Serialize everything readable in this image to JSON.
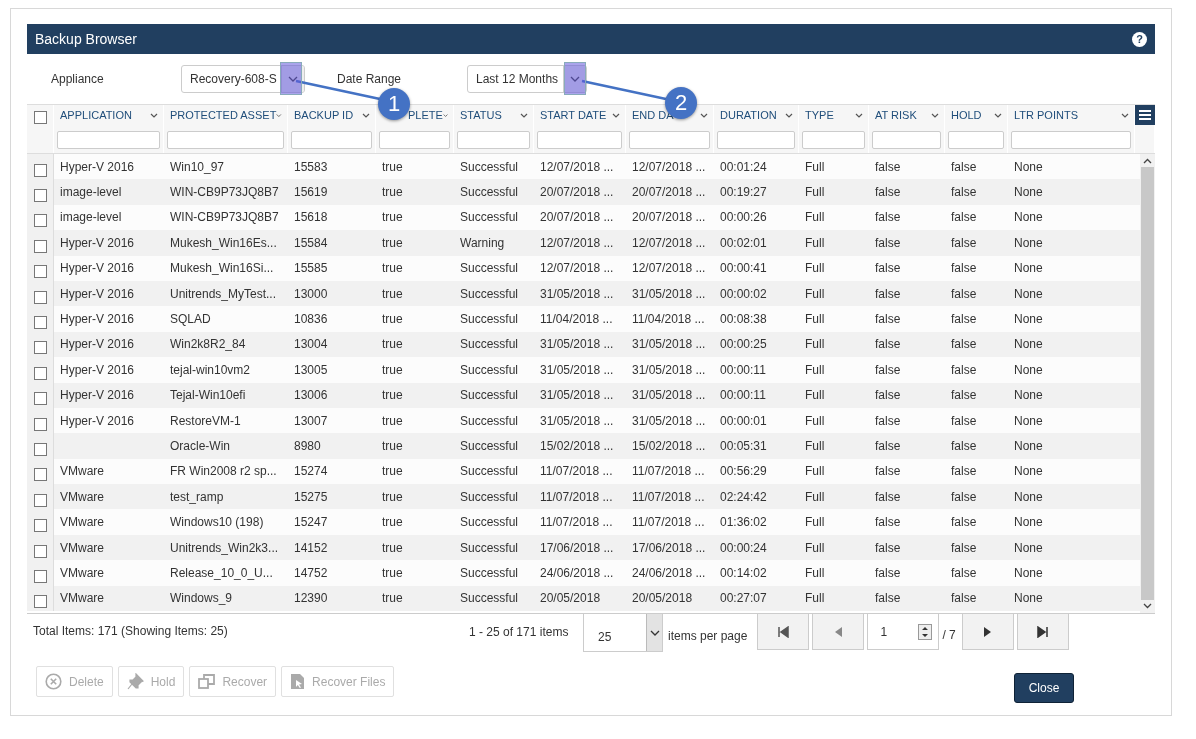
{
  "window": {
    "title": "Backup Browser",
    "help": "?"
  },
  "filters": [
    {
      "label": "Appliance",
      "value": "Recovery-608-S"
    },
    {
      "label": "Date Range",
      "value": "Last 12 Months"
    }
  ],
  "table": {
    "select_all": {
      "checked": false
    },
    "columns": [
      {
        "label": "APPLICATION"
      },
      {
        "label": "PROTECTED ASSET"
      },
      {
        "label": "BACKUP ID"
      },
      {
        "label": "PLETE"
      },
      {
        "label": "STATUS"
      },
      {
        "label": "START DATE"
      },
      {
        "label": "END DA"
      },
      {
        "label": "DURATION"
      },
      {
        "label": "TYPE"
      },
      {
        "label": "AT RISK"
      },
      {
        "label": "HOLD"
      },
      {
        "label": "LTR POINTS"
      }
    ],
    "rows": [
      {
        "checked": false,
        "cells": [
          "Hyper-V 2016",
          "Win10_97",
          "15583",
          "true",
          "Successful",
          "12/07/2018 ...",
          "12/07/2018 ...",
          "00:01:24",
          "Full",
          "false",
          "false",
          "None"
        ]
      },
      {
        "checked": false,
        "cells": [
          "image-level",
          "WIN-CB9P73JQ8B7",
          "15619",
          "true",
          "Successful",
          "20/07/2018 ...",
          "20/07/2018 ...",
          "00:19:27",
          "Full",
          "false",
          "false",
          "None"
        ]
      },
      {
        "checked": false,
        "cells": [
          "image-level",
          "WIN-CB9P73JQ8B7",
          "15618",
          "true",
          "Successful",
          "20/07/2018 ...",
          "20/07/2018 ...",
          "00:00:26",
          "Full",
          "false",
          "false",
          "None"
        ]
      },
      {
        "checked": false,
        "cells": [
          "Hyper-V 2016",
          "Mukesh_Win16Es...",
          "15584",
          "true",
          "Warning",
          "12/07/2018 ...",
          "12/07/2018 ...",
          "00:02:01",
          "Full",
          "false",
          "false",
          "None"
        ]
      },
      {
        "checked": false,
        "cells": [
          "Hyper-V 2016",
          "Mukesh_Win16Si...",
          "15585",
          "true",
          "Successful",
          "12/07/2018 ...",
          "12/07/2018 ...",
          "00:00:41",
          "Full",
          "false",
          "false",
          "None"
        ]
      },
      {
        "checked": false,
        "cells": [
          "Hyper-V 2016",
          "Unitrends_MyTest...",
          "13000",
          "true",
          "Successful",
          "31/05/2018 ...",
          "31/05/2018 ...",
          "00:00:02",
          "Full",
          "false",
          "false",
          "None"
        ]
      },
      {
        "checked": false,
        "cells": [
          "Hyper-V 2016",
          "SQLAD",
          "10836",
          "true",
          "Successful",
          "11/04/2018 ...",
          "11/04/2018 ...",
          "00:08:38",
          "Full",
          "false",
          "false",
          "None"
        ]
      },
      {
        "checked": false,
        "cells": [
          "Hyper-V 2016",
          "Win2k8R2_84",
          "13004",
          "true",
          "Successful",
          "31/05/2018 ...",
          "31/05/2018 ...",
          "00:00:25",
          "Full",
          "false",
          "false",
          "None"
        ]
      },
      {
        "checked": false,
        "cells": [
          "Hyper-V 2016",
          "tejal-win10vm2",
          "13005",
          "true",
          "Successful",
          "31/05/2018 ...",
          "31/05/2018 ...",
          "00:00:11",
          "Full",
          "false",
          "false",
          "None"
        ]
      },
      {
        "checked": false,
        "cells": [
          "Hyper-V 2016",
          "Tejal-Win10efi",
          "13006",
          "true",
          "Successful",
          "31/05/2018 ...",
          "31/05/2018 ...",
          "00:00:11",
          "Full",
          "false",
          "false",
          "None"
        ]
      },
      {
        "checked": false,
        "cells": [
          "Hyper-V 2016",
          "RestoreVM-1",
          "13007",
          "true",
          "Successful",
          "31/05/2018 ...",
          "31/05/2018 ...",
          "00:00:01",
          "Full",
          "false",
          "false",
          "None"
        ]
      },
      {
        "checked": false,
        "cells": [
          null,
          "Oracle-Win",
          "8980",
          "true",
          "Successful",
          "15/02/2018 ...",
          "15/02/2018 ...",
          "00:05:31",
          "Full",
          "false",
          "false",
          "None"
        ]
      },
      {
        "checked": false,
        "cells": [
          "VMware",
          "FR Win2008 r2 sp...",
          "15274",
          "true",
          "Successful",
          "11/07/2018 ...",
          "11/07/2018 ...",
          "00:56:29",
          "Full",
          "false",
          "false",
          "None"
        ]
      },
      {
        "checked": false,
        "cells": [
          "VMware",
          "test_ramp",
          "15275",
          "true",
          "Successful",
          "11/07/2018 ...",
          "11/07/2018 ...",
          "02:24:42",
          "Full",
          "false",
          "false",
          "None"
        ]
      },
      {
        "checked": false,
        "cells": [
          "VMware",
          "Windows10 (198)",
          "15247",
          "true",
          "Successful",
          "11/07/2018 ...",
          "11/07/2018 ...",
          "01:36:02",
          "Full",
          "false",
          "false",
          "None"
        ]
      },
      {
        "checked": false,
        "cells": [
          "VMware",
          "Unitrends_Win2k3...",
          "14152",
          "true",
          "Successful",
          "17/06/2018 ...",
          "17/06/2018 ...",
          "00:00:24",
          "Full",
          "false",
          "false",
          "None"
        ]
      },
      {
        "checked": false,
        "cells": [
          "VMware",
          "Release_10_0_U...",
          "14752",
          "true",
          "Successful",
          "24/06/2018 ...",
          "24/06/2018 ...",
          "00:14:02",
          "Full",
          "false",
          "false",
          "None"
        ]
      },
      {
        "checked": false,
        "cells": [
          "VMware",
          "Windows_9",
          "12390",
          "true",
          "Successful",
          "20/05/2018",
          "20/05/2018",
          "00:27:07",
          "Full",
          "false",
          "false",
          "None"
        ]
      }
    ]
  },
  "footer": {
    "total": "Total Items: 171 (Showing Items: 25)",
    "range": "1 - 25 of 171 items",
    "page_size": "25",
    "per_page_label": "items per page",
    "page": "1",
    "page_count": "/ 7"
  },
  "actions": [
    {
      "label": "Delete",
      "kind": "delete",
      "disabled": true
    },
    {
      "label": "Hold",
      "kind": "hold",
      "disabled": true
    },
    {
      "label": "Recover",
      "kind": "recover",
      "disabled": true
    },
    {
      "label": "Recover Files",
      "kind": "files",
      "disabled": true
    }
  ],
  "close": "Close",
  "callouts": [
    {
      "label": "1"
    },
    {
      "label": "2"
    }
  ]
}
